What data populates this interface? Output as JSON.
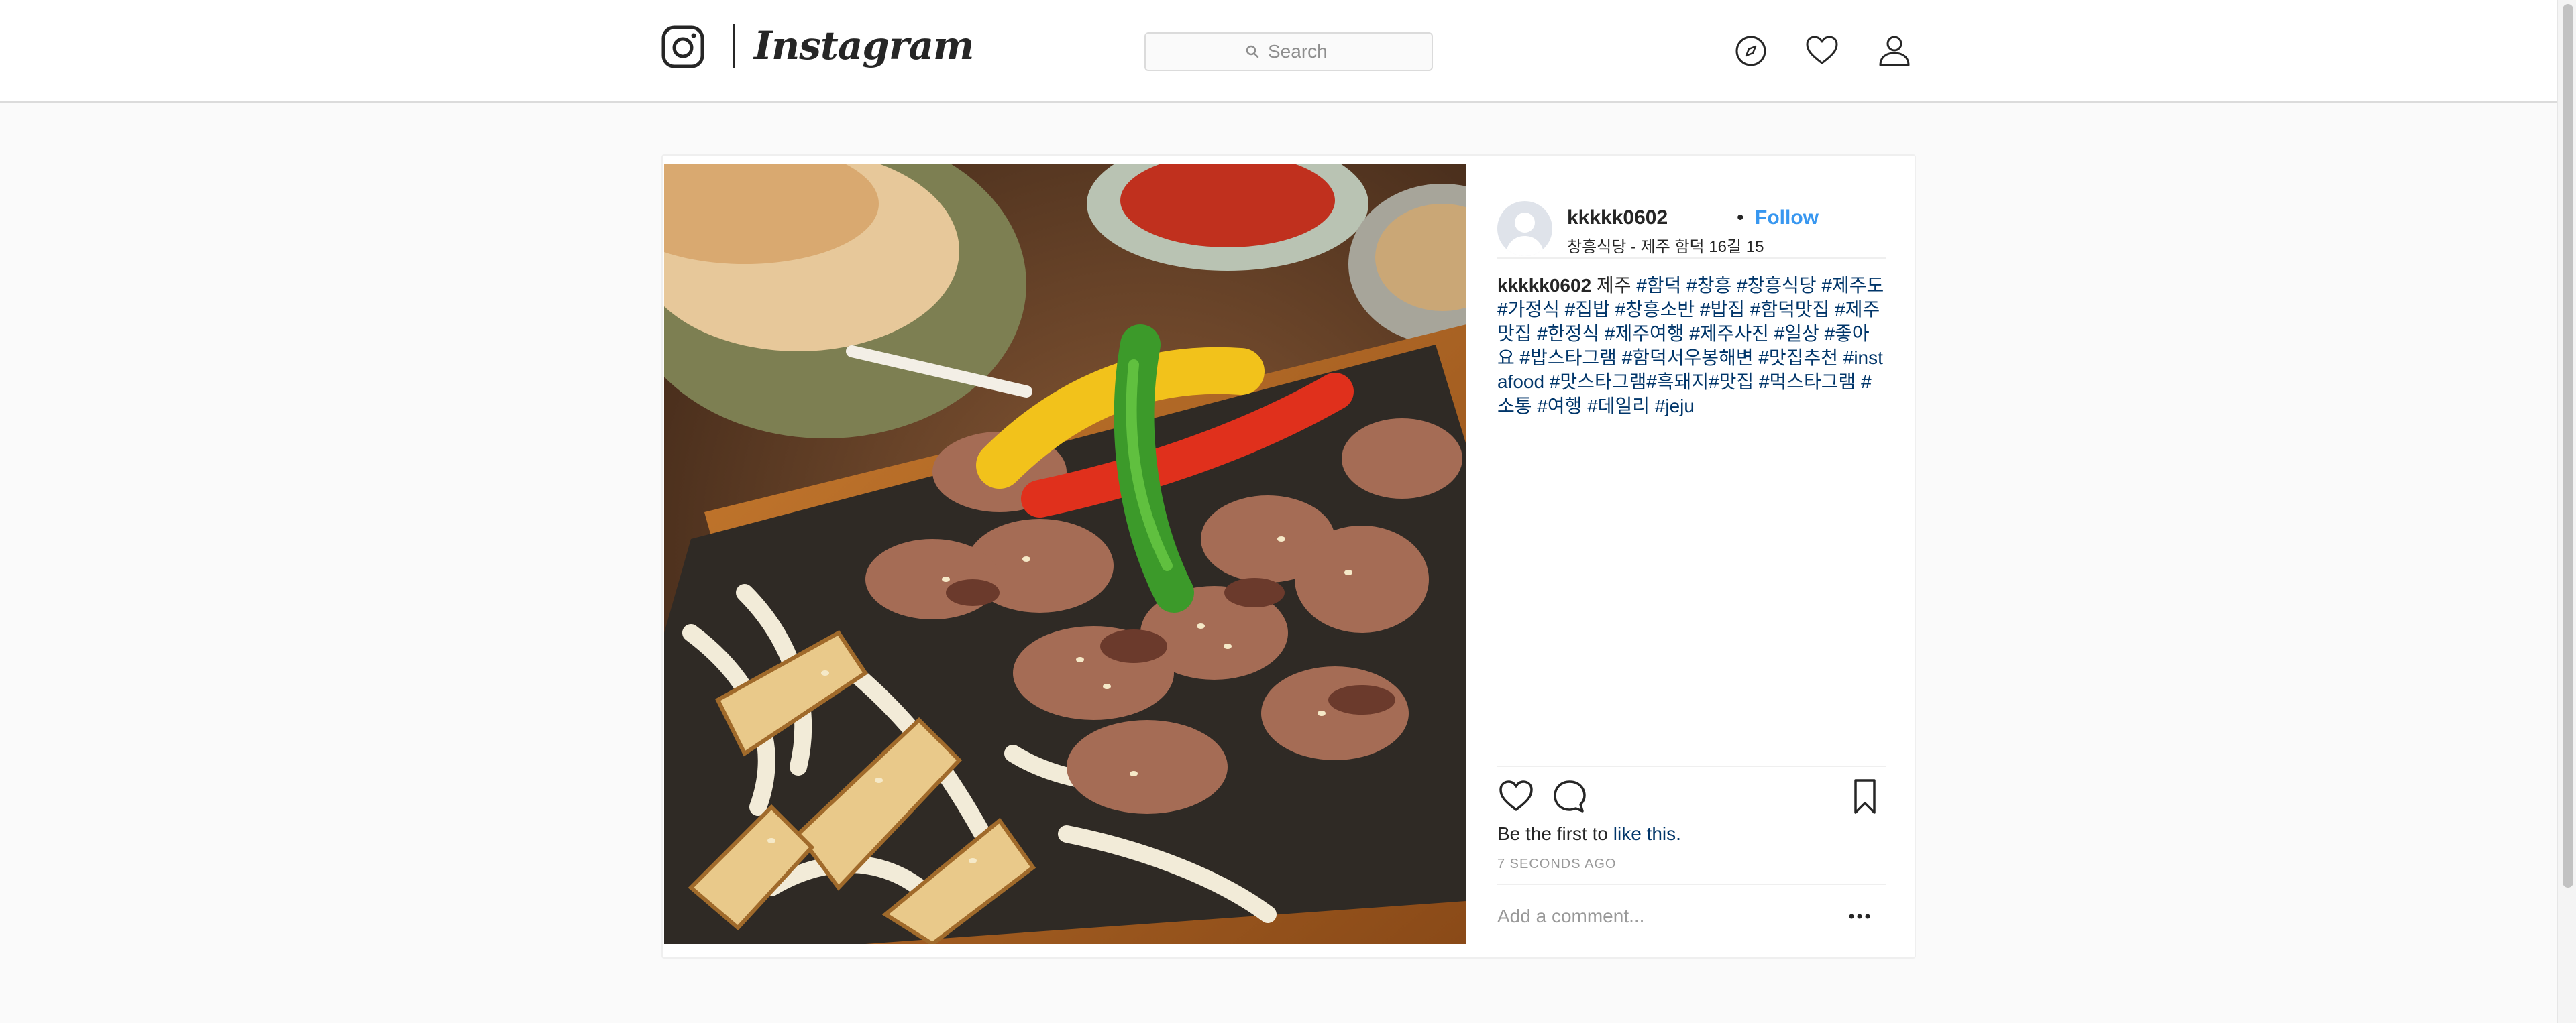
{
  "header": {
    "logo_text": "Instagram",
    "search": {
      "placeholder": "Search",
      "value": "",
      "icon": "search-icon"
    },
    "nav_icons": [
      "compass-icon",
      "heart-icon",
      "user-icon"
    ]
  },
  "post": {
    "author": {
      "username": "kkkkk0602",
      "separator": "•",
      "follow_label": "Follow",
      "location": "창흥식당 - 제주 함덕 16길 15"
    },
    "caption": {
      "username": "kkkkk0602",
      "text": "제주",
      "hashtags": "#함덕 #창흥 #창흥식당 #제주도 #가정식 #집밥 #창흥소반 #밥집 #함덕맛집 #제주맛집 #한정식 #제주여행 #제주사진 #일상 #좋아요 #밥스타그램 #함덕서우봉해변 #맛집추천 #instafood #맛스타그램#흑돼지#맛집 #먹스타그램 #소통 #여행 #데일리 #jeju"
    },
    "likes": {
      "prefix": "Be the first to",
      "link": "like this."
    },
    "timestamp": "7 SECONDS AGO",
    "comment_box": {
      "placeholder": "Add a comment..."
    }
  },
  "colors": {
    "accent": "#3897f0",
    "hashtag": "#003569",
    "muted": "#999999",
    "border": "#dbdbdb"
  }
}
